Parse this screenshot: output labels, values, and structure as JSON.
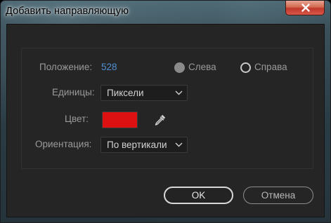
{
  "window": {
    "title": "Добавить направляющую"
  },
  "form": {
    "position": {
      "label": "Положение:",
      "value": "528"
    },
    "side_left": {
      "label": "Слева",
      "checked": true
    },
    "side_right": {
      "label": "Справа",
      "checked": false
    },
    "units": {
      "label": "Единицы:",
      "selected": "Пиксели"
    },
    "color": {
      "label": "Цвет:",
      "swatch": "#dd1111"
    },
    "orientation": {
      "label": "Ориентация:",
      "selected": "По вертикали"
    }
  },
  "buttons": {
    "ok_label": "OK",
    "cancel_label": "Отмена"
  },
  "icons": {
    "close": "close-icon",
    "chevron": "chevron-down-icon",
    "eyedropper": "eyedropper-icon"
  }
}
